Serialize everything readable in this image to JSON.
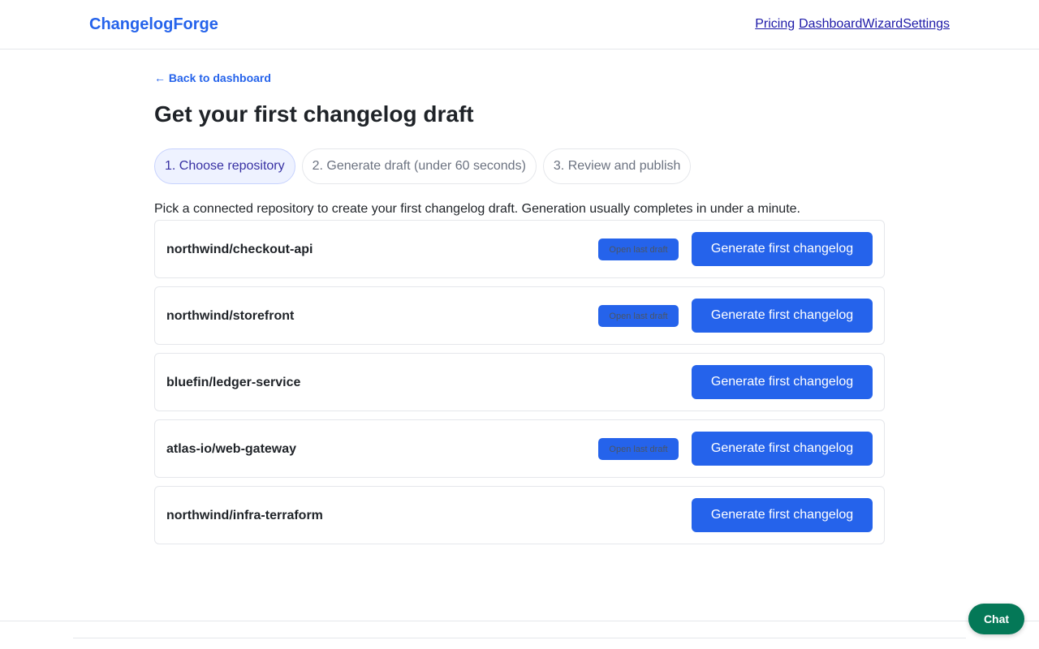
{
  "header": {
    "brand": "ChangelogForge",
    "nav": [
      "Pricing",
      "Dashboard",
      "Wizard",
      "Settings"
    ]
  },
  "back_link": "← Back to dashboard",
  "page_title": "Get your first changelog draft",
  "steps": [
    {
      "label": "1. Choose repository",
      "active": true
    },
    {
      "label": "2. Generate draft (under 60 seconds)",
      "active": false
    },
    {
      "label": "3. Review and publish",
      "active": false
    }
  ],
  "description": "Pick a connected repository to create your first changelog draft. Generation usually completes in under a minute.",
  "repos": [
    {
      "name": "northwind/checkout-api",
      "open_draft": "Open last draft",
      "has_draft": true,
      "generate": "Generate first changelog"
    },
    {
      "name": "northwind/storefront",
      "open_draft": "Open last draft",
      "has_draft": true,
      "generate": "Generate first changelog"
    },
    {
      "name": "bluefin/ledger-service",
      "open_draft": "",
      "has_draft": false,
      "generate": "Generate first changelog"
    },
    {
      "name": "atlas-io/web-gateway",
      "open_draft": "Open last draft",
      "has_draft": true,
      "generate": "Generate first changelog"
    },
    {
      "name": "northwind/infra-terraform",
      "open_draft": "",
      "has_draft": false,
      "generate": "Generate first changelog"
    }
  ],
  "chat_label": "Chat",
  "colors": {
    "accent": "#2563eb",
    "chat": "#047857",
    "active_step_bg": "#eef2ff",
    "active_step_text": "#3730a3"
  }
}
